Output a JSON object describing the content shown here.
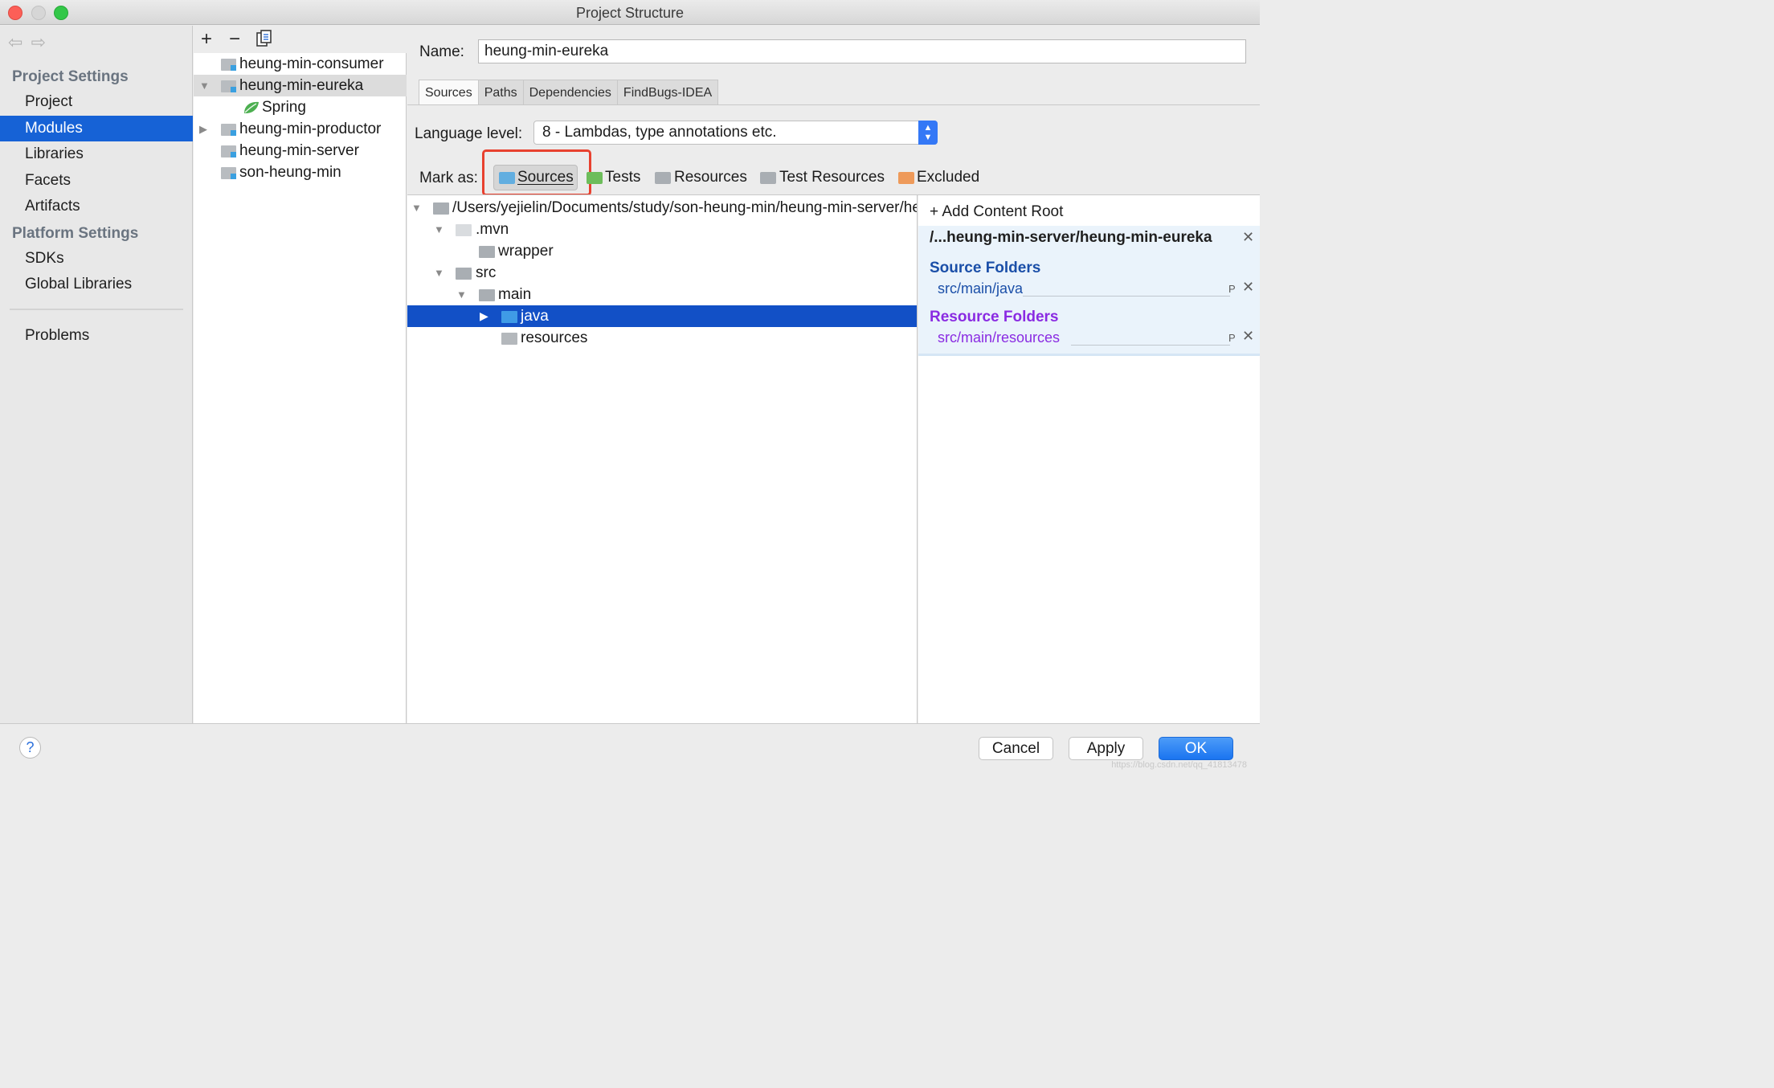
{
  "window": {
    "title": "Project Structure"
  },
  "nav": {
    "back_icon": "arrow-left-icon",
    "forward_icon": "arrow-right-icon",
    "project_settings_header": "Project Settings",
    "project_settings": [
      "Project",
      "Modules",
      "Libraries",
      "Facets",
      "Artifacts"
    ],
    "platform_settings_header": "Platform Settings",
    "platform_settings": [
      "SDKs",
      "Global Libraries"
    ],
    "problems": "Problems",
    "selected": "Modules"
  },
  "modules": {
    "toolbar": {
      "add": "+",
      "remove": "−",
      "copy_icon": "copy-icon"
    },
    "items": [
      {
        "label": "heung-min-consumer",
        "expander": ""
      },
      {
        "label": "heung-min-eureka",
        "expander": "▼"
      },
      {
        "label": "Spring",
        "expander": ""
      },
      {
        "label": "heung-min-productor",
        "expander": "▶"
      },
      {
        "label": "heung-min-server",
        "expander": ""
      },
      {
        "label": "son-heung-min",
        "expander": ""
      }
    ]
  },
  "content": {
    "name_label": "Name:",
    "name_value": "heung-min-eureka",
    "tabs": [
      "Sources",
      "Paths",
      "Dependencies",
      "FindBugs-IDEA"
    ],
    "active_tab": "Sources",
    "language_level_label": "Language level:",
    "language_level_value": "8 - Lambdas, type annotations etc.",
    "mark_as_label": "Mark as:",
    "mark_as": {
      "sources": "Sources",
      "tests": "Tests",
      "resources": "Resources",
      "test_resources": "Test Resources",
      "excluded": "Excluded"
    }
  },
  "filetree": {
    "items": [
      {
        "label": "/Users/yejielin/Documents/study/son-heung-min/heung-min-server/heung-min-eureka",
        "expander": "▼"
      },
      {
        "label": ".mvn",
        "expander": "▼"
      },
      {
        "label": "wrapper",
        "expander": ""
      },
      {
        "label": "src",
        "expander": "▼"
      },
      {
        "label": "main",
        "expander": "▼"
      },
      {
        "label": "java",
        "expander": "▶"
      },
      {
        "label": "resources",
        "expander": ""
      }
    ],
    "selected": "java"
  },
  "content_root": {
    "add_label": "Add Content Root",
    "path": "/...heung-min-server/heung-min-eureka",
    "source_folders_header": "Source Folders",
    "source_folder": "src/main/java",
    "resource_folders_header": "Resource Folders",
    "resource_folder": "src/main/resources",
    "properties_glyph": "P",
    "colors": {
      "source": "#1b4fa8",
      "resource": "#8a2be2"
    }
  },
  "buttons": {
    "help": "?",
    "cancel": "Cancel",
    "apply": "Apply",
    "ok": "OK"
  },
  "watermark": "https://blog.csdn.net/qq_41813478"
}
